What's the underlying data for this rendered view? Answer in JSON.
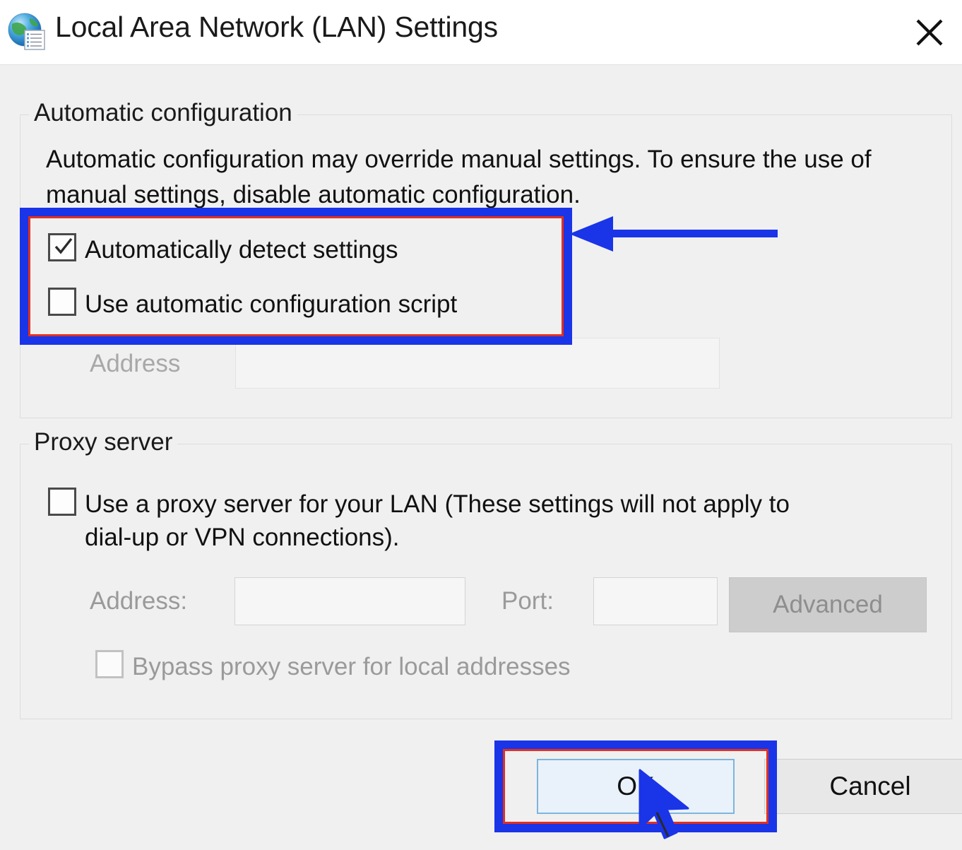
{
  "window": {
    "title": "Local Area Network (LAN) Settings",
    "icon": "globe-settings-icon",
    "close_label": "✕"
  },
  "auto_config": {
    "legend": "Automatic configuration",
    "description": "Automatic configuration may override manual settings.  To ensure the use of manual settings, disable automatic configuration.",
    "checkbox_detect": {
      "label": "Automatically detect settings",
      "checked": true,
      "enabled": true
    },
    "checkbox_script": {
      "label": "Use automatic configuration script",
      "checked": false,
      "enabled": true
    },
    "address_label": "Address",
    "address_value": "",
    "address_enabled": false
  },
  "proxy": {
    "legend": "Proxy server",
    "checkbox_useproxy": {
      "label": "Use a proxy server for your LAN (These settings will not apply to\ndial-up or VPN connections).",
      "checked": false,
      "enabled": true
    },
    "address_label": "Address:",
    "address_value": "",
    "port_label": "Port:",
    "port_value": "",
    "advanced_label": "Advanced",
    "advanced_enabled": false,
    "checkbox_bypass": {
      "label": "Bypass proxy server for local addresses",
      "checked": false,
      "enabled": false
    }
  },
  "footer": {
    "ok_label": "OK",
    "cancel_label": "Cancel"
  },
  "annotations": {
    "highlight_color": "#1a34e8",
    "highlight_inner_color": "#e03020",
    "arrow_color": "#1a34e8",
    "cursor_color": "#1a34e8",
    "boxes": [
      {
        "name": "checkbox-group-highlight",
        "target": "Automatically detect settings / Use automatic configuration script"
      },
      {
        "name": "ok-button-highlight",
        "target": "OK"
      }
    ],
    "arrow": {
      "name": "left-pointing-arrow",
      "points_to": "checkbox-group-highlight"
    },
    "cursor": {
      "name": "mouse-pointer",
      "over": "OK"
    }
  }
}
